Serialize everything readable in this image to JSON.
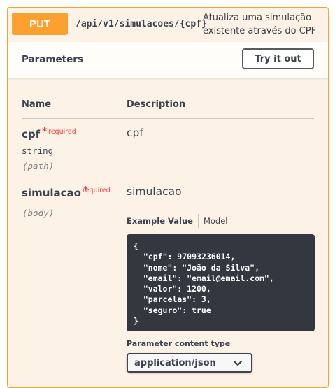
{
  "operation": {
    "method": "PUT",
    "path": "/api/v1/simulacoes/{cpf}",
    "summary": "Atualiza uma simulação existente através do CPF"
  },
  "parameters_section": {
    "title": "Parameters",
    "try_button": "Try it out",
    "col_name": "Name",
    "col_description": "Description"
  },
  "params": [
    {
      "name": "cpf",
      "star": "*",
      "required": "required",
      "type": "string",
      "in": "(path)",
      "description": "cpf"
    },
    {
      "name": "simulacao",
      "star": "*",
      "required": "required",
      "in": "(body)",
      "description": "simulacao"
    }
  ],
  "body_tabs": {
    "example": "Example Value",
    "model": "Model"
  },
  "example_json": "{\n  \"cpf\": 97093236014,\n  \"nome\": \"João da Silva\",\n  \"email\": \"email@email.com\",\n  \"valor\": 1200,\n  \"parcelas\": 3,\n  \"seguro\": true\n}",
  "content_type": {
    "label": "Parameter content type",
    "selected": "application/json"
  },
  "colors": {
    "put_accent": "#fca130",
    "block_bg": "#fcf2e5",
    "required": "#ff3b3b",
    "code_bg": "#333840"
  }
}
